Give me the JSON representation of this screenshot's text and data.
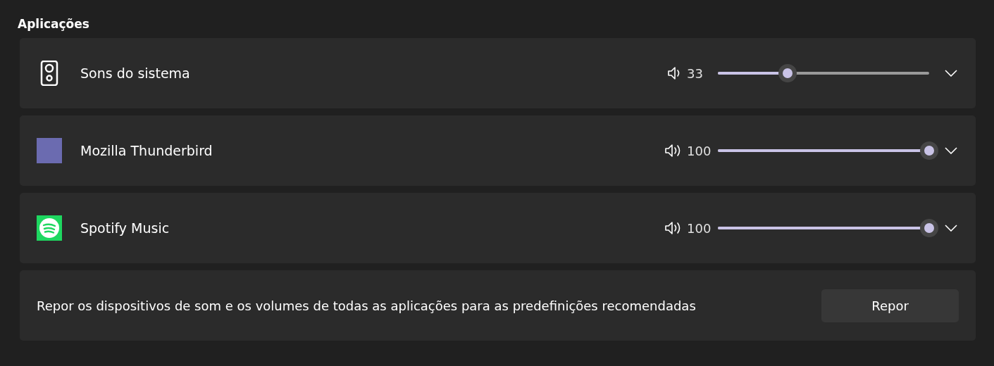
{
  "section_title": "Aplicações",
  "apps": [
    {
      "kind": "system",
      "name": "Sons do sistema",
      "volume": "33",
      "level": 0.33
    },
    {
      "kind": "tile",
      "name": "Mozilla Thunderbird",
      "volume": "100",
      "level": 1
    },
    {
      "kind": "spotify",
      "name": "Spotify Music",
      "volume": "100",
      "level": 1
    }
  ],
  "reset": {
    "text": "Repor os dispositivos de som e os volumes de todas as aplicações para as predefinições recomendadas",
    "button": "Repor"
  }
}
